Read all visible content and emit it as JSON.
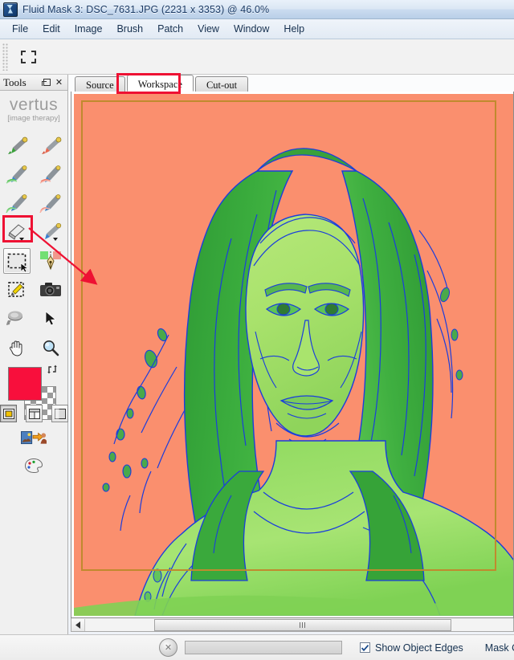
{
  "window": {
    "title": "Fluid Mask 3: DSC_7631.JPG (2231 x 3353) @ 46.0%",
    "app_icon": "fluid-mask-app-icon"
  },
  "menubar": {
    "items": [
      {
        "label": "File"
      },
      {
        "label": "Edit"
      },
      {
        "label": "Image"
      },
      {
        "label": "Brush"
      },
      {
        "label": "Patch"
      },
      {
        "label": "View"
      },
      {
        "label": "Window"
      },
      {
        "label": "Help"
      }
    ]
  },
  "subtoolbar": {
    "grip": "drag-handle",
    "buttons": [
      {
        "name": "marquee-select-button",
        "icon": "dashed-rectangle-icon"
      }
    ]
  },
  "tools_panel": {
    "title": "Tools",
    "float_icon": "restore-window-icon",
    "close_icon": "close-icon",
    "brand": {
      "name": "vertus",
      "tagline": "[image therapy]"
    },
    "tools": [
      {
        "name": "keep-brush-tool",
        "icon": "green-marker-icon",
        "label": "Keep Brush"
      },
      {
        "name": "delete-brush-tool",
        "icon": "red-marker-icon",
        "label": "Delete Brush"
      },
      {
        "name": "keep-edge-brush-tool",
        "icon": "green-edge-brush-icon",
        "label": "Keep Edge Brush"
      },
      {
        "name": "delete-edge-brush-tool",
        "icon": "red-edge-brush-icon",
        "label": "Delete Edge Brush"
      },
      {
        "name": "keep-blend-brush-tool",
        "icon": "green-blend-brush-icon",
        "label": "Keep Blending Brush"
      },
      {
        "name": "delete-blend-brush-tool",
        "icon": "red-blend-brush-icon",
        "label": "Delete Blending Brush"
      },
      {
        "name": "eraser-tool",
        "icon": "eraser-icon",
        "label": "Eraser"
      },
      {
        "name": "blue-brush-tool",
        "icon": "blue-marker-icon",
        "label": "Blend Brush"
      },
      {
        "name": "marquee-tool",
        "icon": "dashed-rectangle-icon",
        "label": "Rectangle Select"
      },
      {
        "name": "pen-path-tool",
        "icon": "fountain-pen-icon",
        "label": "Object Pen"
      },
      {
        "name": "magic-wand-tool",
        "icon": "magic-wand-icon",
        "label": "Magic Wand"
      },
      {
        "name": "camera-tool",
        "icon": "camera-icon",
        "label": "Snapshot"
      },
      {
        "name": "patch-tool",
        "icon": "patch-spoon-icon",
        "label": "Patch"
      },
      {
        "name": "pointer-tool",
        "icon": "arrow-pointer-icon",
        "label": "Pointer"
      },
      {
        "name": "hand-tool",
        "icon": "hand-icon",
        "label": "Pan"
      },
      {
        "name": "zoom-tool",
        "icon": "magnifier-icon",
        "label": "Zoom"
      }
    ],
    "active_tool": "marquee-tool",
    "swatch": {
      "foreground_color": "#f80f3c",
      "swap_icon": "swap-colors-icon",
      "checker": "transparency-checker"
    },
    "extra_buttons": [
      {
        "name": "blend-preview-button",
        "icon": "image-swap-icon"
      },
      {
        "name": "palette-button",
        "icon": "palette-icon"
      }
    ],
    "view_modes": [
      {
        "name": "view-mode-single",
        "icon": "single-pane-icon",
        "selected": true
      },
      {
        "name": "view-mode-split",
        "icon": "split-pane-icon",
        "selected": false
      },
      {
        "name": "view-mode-blank",
        "icon": "blank-pane-icon",
        "selected": false
      }
    ]
  },
  "tabs": [
    {
      "label": "Source",
      "active": false
    },
    {
      "label": "Workspace",
      "active": true
    },
    {
      "label": "Cut-out",
      "active": false
    }
  ],
  "canvas": {
    "background_color": "#FA8F6E",
    "mask_keep_color": "#7ED957",
    "mask_dark_color": "#2E9B35",
    "edge_color": "#1a3ddd",
    "selection_rect_color": "#c08a2e",
    "image_description": "portrait-with-green-mask-overlay"
  },
  "scrollbar": {
    "left_arrow_icon": "triangle-left-icon",
    "thumb_grip_icon": "grip-lines-icon"
  },
  "statusbar": {
    "stop_button_icon": "cancel-icon",
    "progress_value": "",
    "show_object_edges": {
      "label": "Show Object Edges",
      "checked": true
    },
    "mask_label": "Mask O"
  },
  "annotations": {
    "tool_highlight_color": "#ee1133",
    "tab_highlight_color": "#ee1133",
    "arrow_color": "#ee1133"
  }
}
